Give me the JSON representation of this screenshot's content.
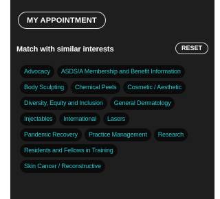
{
  "appointment_button": {
    "label": "MY APPOINTMENT"
  },
  "interests": {
    "title": "Match with similar interests",
    "reset_label": "RESET",
    "rows": [
      [
        "Advocacy",
        "ASDS/A Membership and Benefit Information"
      ],
      [
        "Body Sculpting",
        "Chemical Peels",
        "Cosmetic / Aesthetic"
      ],
      [
        "Diversity, Equity and Inclusion",
        "General Dermatology"
      ],
      [
        "Injectables",
        "International",
        "Lasers"
      ],
      [
        "Pandemic Recovery",
        "Practice Management",
        "Research"
      ],
      [
        "Residents and Fellows in Training"
      ],
      [
        "Skin Cancer / Reconstructive"
      ]
    ]
  },
  "colors": {
    "panel_bg": "#1e1e1e",
    "tag_bg": "#0b0b0b",
    "tag_text": "#2cc3c7"
  }
}
